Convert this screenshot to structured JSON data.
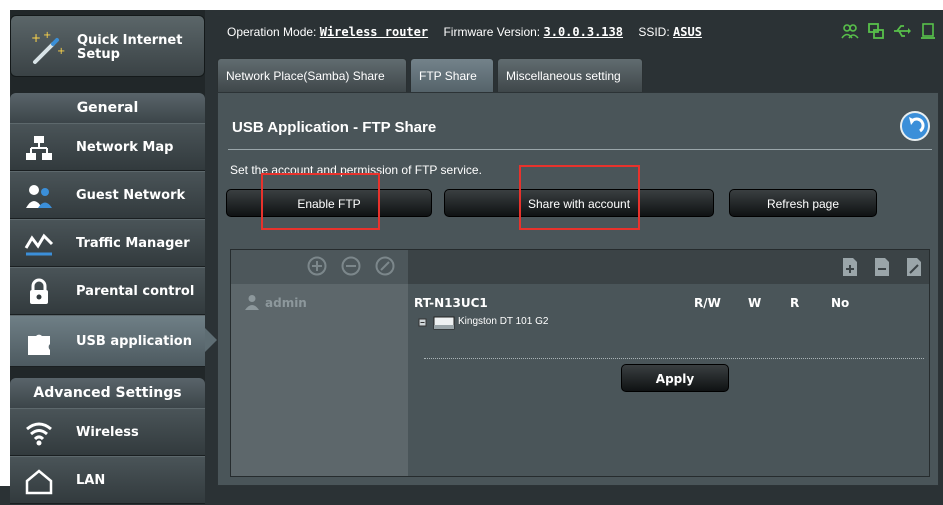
{
  "sidebar": {
    "quick_setup": {
      "label": "Quick Internet Setup"
    },
    "general_header": "General",
    "general_items": [
      {
        "label": "Network Map",
        "icon": "network-map-icon"
      },
      {
        "label": "Guest Network",
        "icon": "guest-network-icon"
      },
      {
        "label": "Traffic Manager",
        "icon": "traffic-manager-icon"
      },
      {
        "label": "Parental control",
        "icon": "parental-control-icon"
      },
      {
        "label": "USB application",
        "icon": "usb-application-icon",
        "active": true
      }
    ],
    "advanced_header": "Advanced Settings",
    "advanced_items": [
      {
        "label": "Wireless",
        "icon": "wireless-icon"
      },
      {
        "label": "LAN",
        "icon": "lan-icon"
      }
    ]
  },
  "topbar": {
    "operation_mode_label": "Operation Mode:",
    "operation_mode_value": "Wireless router",
    "firmware_label": "Firmware Version:",
    "firmware_value": "3.0.0.3.138",
    "ssid_label": "SSID:",
    "ssid_value": "ASUS",
    "status_icons": [
      "users-icon",
      "network-status-icon",
      "usb-status-icon",
      "printer-icon"
    ]
  },
  "tabs": [
    {
      "label": "Network Place(Samba) Share"
    },
    {
      "label": "FTP Share",
      "active": true
    },
    {
      "label": "Miscellaneous setting"
    }
  ],
  "panel": {
    "title": "USB Application - FTP Share",
    "description": "Set the account and permission of FTP service.",
    "buttons": {
      "enable_ftp": "Enable FTP",
      "share_with_account": "Share with account",
      "refresh": "Refresh page"
    }
  },
  "table": {
    "account": "admin",
    "device": "RT-N13UC1",
    "permissions": [
      "R/W",
      "W",
      "R",
      "No"
    ],
    "disk": "Kingston DT 101 G2",
    "apply_label": "Apply"
  },
  "colors": {
    "highlight": "#e8322c",
    "accent": "#3b8fd9"
  }
}
